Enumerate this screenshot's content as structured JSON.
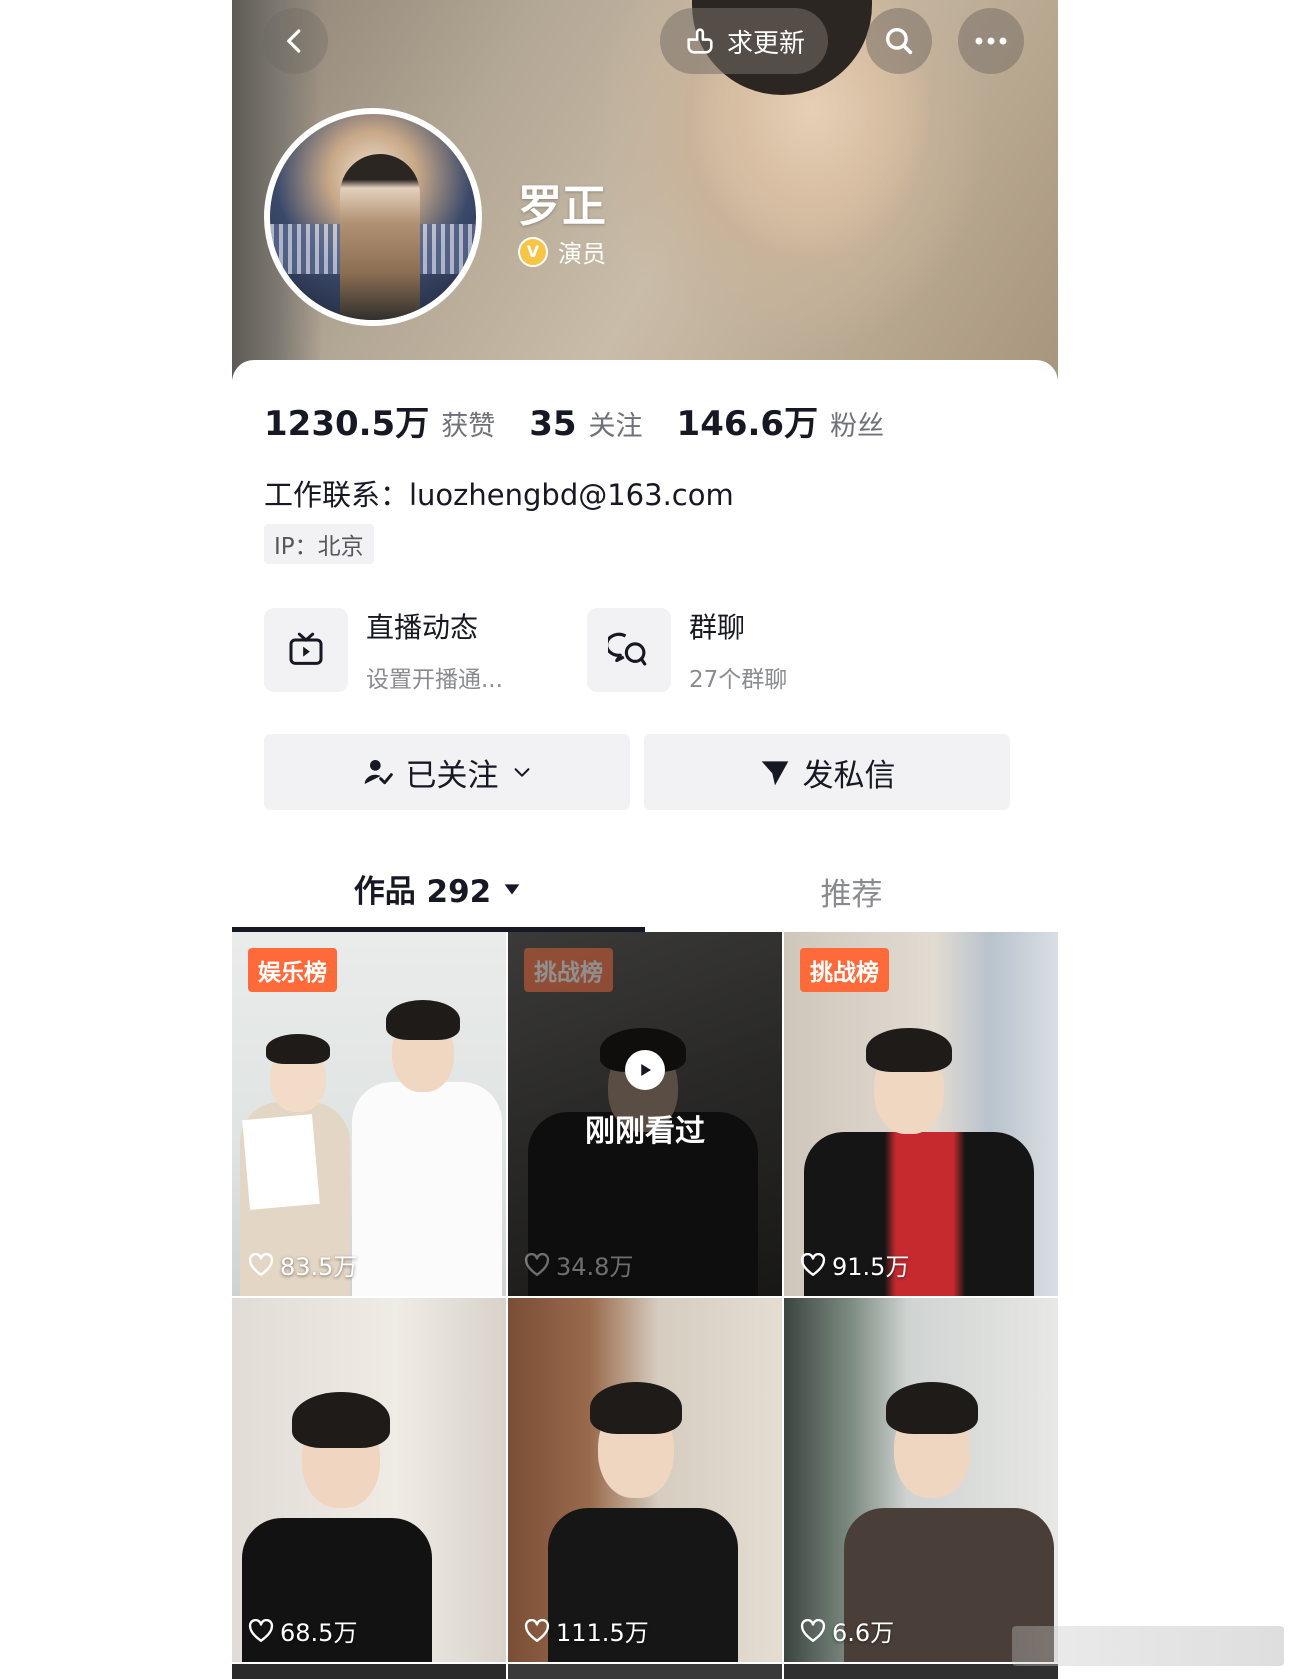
{
  "header": {
    "update_label": "求更新"
  },
  "profile": {
    "name": "罗正",
    "verify_label": "演员"
  },
  "stats": [
    {
      "value": "1230.5万",
      "label": "获赞"
    },
    {
      "value": "35",
      "label": "关注"
    },
    {
      "value": "146.6万",
      "label": "粉丝"
    }
  ],
  "contact": "工作联系：luozhengbd@163.com",
  "ip": "IP：北京",
  "entries": [
    {
      "title": "直播动态",
      "subtitle": "设置开播通...",
      "icon": "tv-play-icon"
    },
    {
      "title": "群聊",
      "subtitle": "27个群聊",
      "icon": "chat-bubbles-icon"
    }
  ],
  "actions": {
    "followed_label": "已关注",
    "message_label": "发私信"
  },
  "tabs": {
    "works_label": "作品 292",
    "recommend_label": "推荐"
  },
  "videos": [
    {
      "badge": "娱乐榜",
      "likes": "83.5万"
    },
    {
      "badge": "挑战榜",
      "likes": "34.8万",
      "overlay": "刚刚看过"
    },
    {
      "badge": "挑战榜",
      "likes": "91.5万"
    },
    {
      "badge": "",
      "likes": "68.5万"
    },
    {
      "badge": "",
      "likes": "111.5万"
    },
    {
      "badge": "",
      "likes": "6.6万"
    }
  ],
  "colors": {
    "accent_badge": "#fe6a3a",
    "verify_badge": "#f6c544",
    "button_bg": "#f2f2f4",
    "text_primary": "#161823",
    "text_secondary": "#8a8b91"
  }
}
